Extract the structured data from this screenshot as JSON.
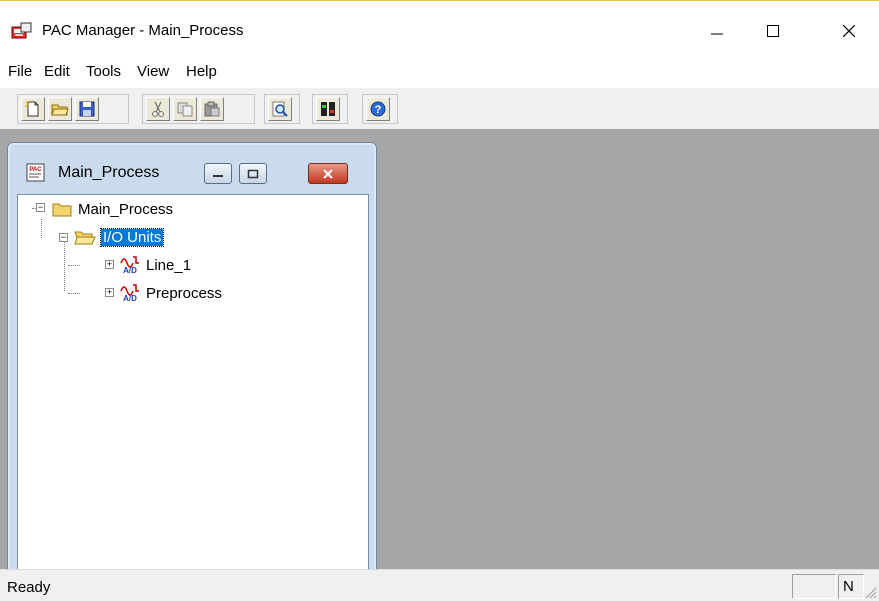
{
  "window": {
    "title": "PAC Manager - Main_Process",
    "app_icon": "pac-manager-icon",
    "controls": [
      "minimize-icon",
      "maximize-icon",
      "close-icon"
    ]
  },
  "menu": {
    "items": [
      "File",
      "Edit",
      "Tools",
      "View",
      "Help"
    ]
  },
  "toolbar": {
    "buttons": [
      {
        "icon": "new-file-icon"
      },
      {
        "icon": "open-folder-icon"
      },
      {
        "icon": "save-icon"
      },
      {
        "icon": "cut-icon"
      },
      {
        "icon": "copy-icon"
      },
      {
        "icon": "paste-icon"
      },
      {
        "icon": "find-icon"
      },
      {
        "icon": "settings-icon"
      },
      {
        "icon": "help-icon"
      }
    ]
  },
  "child_window": {
    "title": "Main_Process",
    "icon": "pac-document-icon"
  },
  "tree": {
    "root": {
      "label": "Main_Process",
      "expanded": true,
      "icon": "folder-icon"
    },
    "group": {
      "label": "I/O Units",
      "expanded": true,
      "selected": true,
      "icon": "open-folder-icon"
    },
    "units": [
      {
        "label": "Line_1",
        "expanded": false,
        "icon": "ad-unit-icon",
        "icon_text": "A/D"
      },
      {
        "label": "Preprocess",
        "expanded": false,
        "icon": "ad-unit-icon",
        "icon_text": "A/D"
      }
    ]
  },
  "status": {
    "text": "Ready",
    "indicator": "N"
  },
  "colors": {
    "mdi_background": "#a7a7a7",
    "selection": "#0078d7",
    "child_frame": "#c9dbed"
  }
}
